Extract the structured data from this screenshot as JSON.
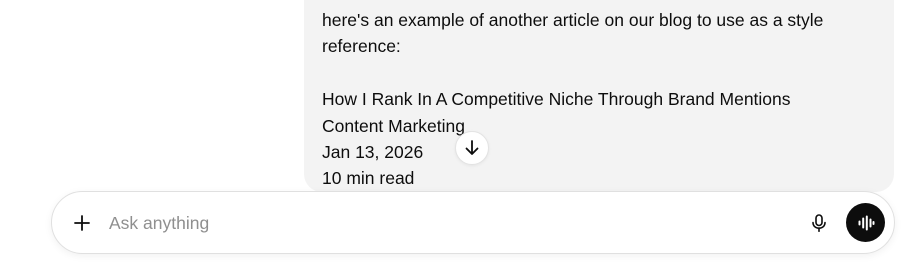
{
  "message": {
    "line1": "here's an example of another article on our blog to use as a style",
    "line2": "reference:",
    "article_title": "How I Rank In A Competitive Niche Through Brand Mentions",
    "article_category": "Content Marketing",
    "article_date": "Jan 13, 2026",
    "article_read_time": "10 min read"
  },
  "composer": {
    "placeholder": "Ask anything"
  },
  "icons": {
    "scroll": "arrow-down-icon",
    "add": "plus-icon",
    "dictate": "microphone-icon",
    "voice": "voice-wave-icon"
  },
  "colors": {
    "bubble_bg": "#f3f3f3",
    "voice_button_bg": "#0d0d0d",
    "placeholder": "#8f8f8f"
  }
}
